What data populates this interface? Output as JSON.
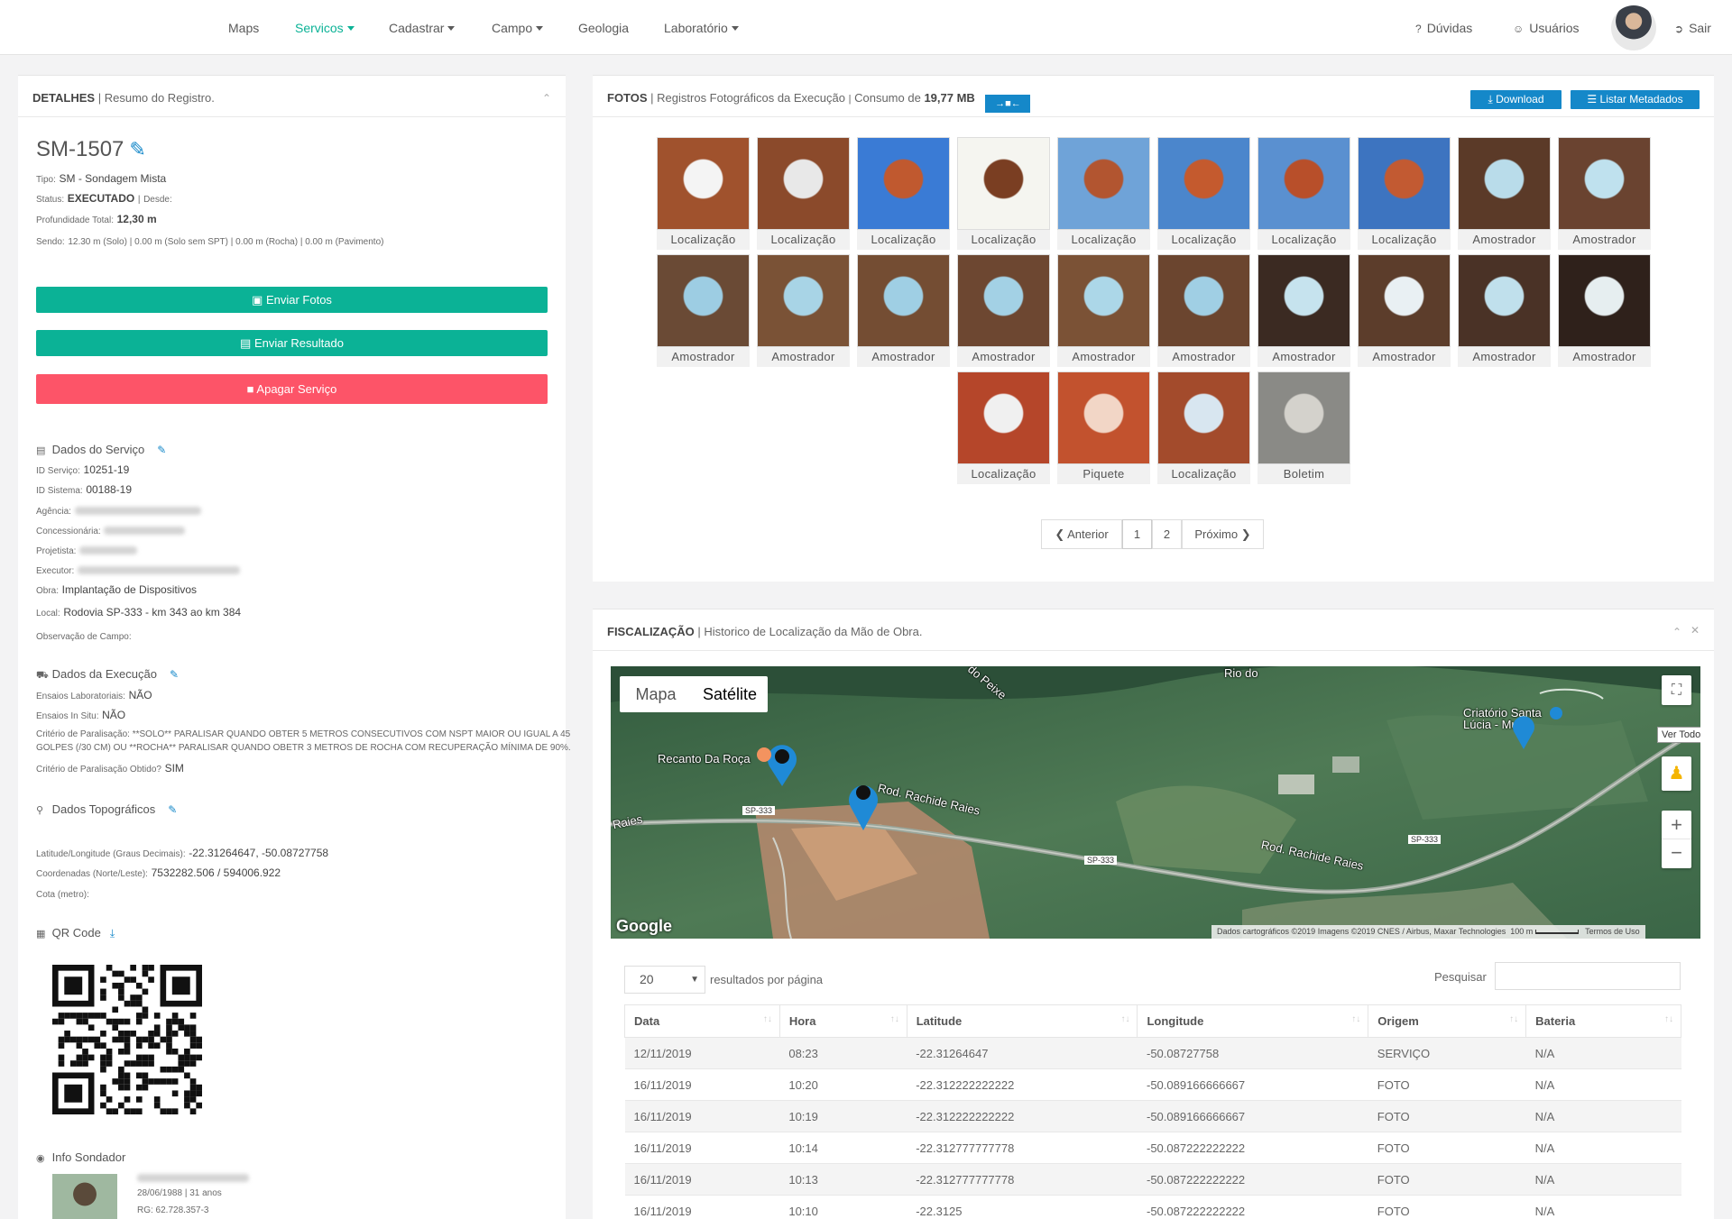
{
  "nav": {
    "items": [
      {
        "label": "Maps",
        "dropdown": false
      },
      {
        "label": "Servicos",
        "dropdown": true
      },
      {
        "label": "Cadastrar",
        "dropdown": true
      },
      {
        "label": "Campo",
        "dropdown": true
      },
      {
        "label": "Geologia",
        "dropdown": false
      },
      {
        "label": "Laboratório",
        "dropdown": true
      }
    ],
    "duvidas": "Dúvidas",
    "usuarios": "Usuários",
    "sair": "Sair",
    "accent": "#0bb296"
  },
  "detalhes": {
    "head_title": "DETALHES",
    "head_sub": "Resumo do Registro.",
    "code": "SM-1507",
    "tipo_label": "Tipo:",
    "tipo": "SM - Sondagem Mista",
    "status_label": "Status:",
    "status": "EXECUTADO",
    "desde_label": "Desde:",
    "prof_label": "Profundidade Total:",
    "prof": "12,30 m",
    "sendo_label": "Sendo:",
    "sendo": "12.30 m (Solo) | 0.00 m (Solo sem SPT) | 0.00 m (Rocha) | 0.00 m (Pavimento)",
    "btn_fotos": "Enviar Fotos",
    "btn_resultado": "Enviar Resultado",
    "btn_apagar": "Apagar Serviço",
    "green": "#0bb296",
    "red": "#fd5468"
  },
  "servico": {
    "title": "Dados do Serviço",
    "id_servico_label": "ID Serviço:",
    "id_servico": "10251-19",
    "id_sistema_label": "ID Sistema:",
    "id_sistema": "00188-19",
    "agencia_label": "Agência:",
    "concessionaria_label": "Concessionária:",
    "projetista_label": "Projetista:",
    "executor_label": "Executor:",
    "obra_label": "Obra:",
    "obra": "Implantação de Dispositivos",
    "local_label": "Local:",
    "local": "Rodovia SP-333 - km 343 ao km 384",
    "obs_label": "Observação de Campo:"
  },
  "execucao": {
    "title": "Dados da Execução",
    "lab_label": "Ensaios Laboratoriais:",
    "lab": "NÃO",
    "insitu_label": "Ensaios In Situ:",
    "insitu": "NÃO",
    "criterio_label": "Critério de Paralisação:",
    "criterio_1": "**SOLO** PARALISAR QUANDO OBTER 5 METROS CONSECUTIVOS COM NSPT MAIOR OU IGUAL A 45",
    "criterio_2": "GOLPES (/30 CM) OU **ROCHA** PARALISAR QUANDO OBETR 3 METROS DE ROCHA COM RECUPERAÇÃO MÍNIMA DE 90%.",
    "obtido_label": "Critério de Paralisação Obtido?",
    "obtido": "SIM"
  },
  "topo": {
    "title": "Dados Topográficos",
    "latlon_label": "Latitude/Longitude (Graus Decimais):",
    "latlon": "-22.31264647, -50.08727758",
    "coord_label": "Coordenadas (Norte/Leste):",
    "coord": "7532282.506 / 594006.922",
    "cota_label": "Cota (metro):"
  },
  "qr": {
    "title": "QR Code"
  },
  "sondador": {
    "title": "Info Sondador",
    "nasc": "28/06/1988 | 31 anos",
    "rg": "RG: 62.728.357-3"
  },
  "fotos": {
    "head_title": "FOTOS",
    "head_sub": "Registros Fotográficos da Execução",
    "consumo_label": "Consumo de",
    "consumo": "19,77 MB",
    "download": "Download",
    "listar": "Listar Metadados",
    "items": [
      {
        "cap": "Localização",
        "c1": "#a0522d",
        "c2": "#f4f4f4"
      },
      {
        "cap": "Localização",
        "c1": "#8b4a2b",
        "c2": "#e8e8e8"
      },
      {
        "cap": "Localização",
        "c1": "#3a7bd5",
        "c2": "#c0592f"
      },
      {
        "cap": "Localização",
        "c1": "#f5f5f0",
        "c2": "#7a3e22"
      },
      {
        "cap": "Localização",
        "c1": "#6fa3d8",
        "c2": "#b25530"
      },
      {
        "cap": "Localização",
        "c1": "#4b86cc",
        "c2": "#c45a2e"
      },
      {
        "cap": "Localização",
        "c1": "#5a90d0",
        "c2": "#b84f2a"
      },
      {
        "cap": "Localização",
        "c1": "#3d74c0",
        "c2": "#c25a32"
      },
      {
        "cap": "Amostrador",
        "c1": "#5b3a28",
        "c2": "#b9dcea"
      },
      {
        "cap": "Amostrador",
        "c1": "#6a4330",
        "c2": "#bfe1ee"
      },
      {
        "cap": "Amostrador",
        "c1": "#6a4a35",
        "c2": "#9dcde3"
      },
      {
        "cap": "Amostrador",
        "c1": "#7a5236",
        "c2": "#a8d4e6"
      },
      {
        "cap": "Amostrador",
        "c1": "#744d33",
        "c2": "#9fcfe4"
      },
      {
        "cap": "Amostrador",
        "c1": "#6d4731",
        "c2": "#a3d1e5"
      },
      {
        "cap": "Amostrador",
        "c1": "#7b5236",
        "c2": "#acd7e8"
      },
      {
        "cap": "Amostrador",
        "c1": "#6b452f",
        "c2": "#a0cfe4"
      },
      {
        "cap": "Amostrador",
        "c1": "#3b2a22",
        "c2": "#c6e3ee"
      },
      {
        "cap": "Amostrador",
        "c1": "#5c3d2b",
        "c2": "#e9f0f3"
      },
      {
        "cap": "Amostrador",
        "c1": "#4a3226",
        "c2": "#c0e0ec"
      },
      {
        "cap": "Amostrador",
        "c1": "#2f211b",
        "c2": "#e6eef0"
      },
      {
        "cap": "Localização",
        "c1": "#b5462a",
        "c2": "#f0f0f0"
      },
      {
        "cap": "Piquete",
        "c1": "#c2522e",
        "c2": "#f2d6c6"
      },
      {
        "cap": "Localização",
        "c1": "#a34b2c",
        "c2": "#d8e6f0"
      },
      {
        "cap": "Boletim",
        "c1": "#8a8a86",
        "c2": "#d4d2cc"
      }
    ],
    "pager": {
      "prev": "Anterior",
      "p1": "1",
      "p2": "2",
      "next": "Próximo"
    }
  },
  "fiscalizacao": {
    "head_title": "FISCALIZAÇÃO",
    "head_sub": "Historico de Localização da Mão de Obra.",
    "map_tab_mapa": "Mapa",
    "map_tab_sat": "Satélite",
    "ver_todos": "Ver Todos",
    "labels": {
      "recanto": "Recanto Da Roça",
      "criatorio1": "Criatório Santa",
      "criatorio2": "Lúcia - Mua",
      "rod1": "Rod. Rachide Raies",
      "rod2": "Rod. Rachide Raies",
      "peixe": "do Peixe",
      "rio": "Rio do",
      "raies": "Raies",
      "sp1": "SP-333",
      "sp2": "SP-333",
      "sp3": "SP-333"
    },
    "google": "Google",
    "attrib": "Dados cartográficos ©2019 Imagens ©2019 CNES / Airbus, Maxar Technologies",
    "scale": "100 m",
    "terms": "Termos de Uso",
    "per_page_value": "20",
    "per_page_label": "resultados por página",
    "search_label": "Pesquisar",
    "columns": [
      "Data",
      "Hora",
      "Latitude",
      "Longitude",
      "Origem",
      "Bateria"
    ],
    "rows": [
      [
        "12/11/2019",
        "08:23",
        "-22.31264647",
        "-50.08727758",
        "SERVIÇO",
        "N/A"
      ],
      [
        "16/11/2019",
        "10:20",
        "-22.312222222222",
        "-50.089166666667",
        "FOTO",
        "N/A"
      ],
      [
        "16/11/2019",
        "10:19",
        "-22.312222222222",
        "-50.089166666667",
        "FOTO",
        "N/A"
      ],
      [
        "16/11/2019",
        "10:14",
        "-22.312777777778",
        "-50.087222222222",
        "FOTO",
        "N/A"
      ],
      [
        "16/11/2019",
        "10:13",
        "-22.312777777778",
        "-50.087222222222",
        "FOTO",
        "N/A"
      ],
      [
        "16/11/2019",
        "10:10",
        "-22.3125",
        "-50.087222222222",
        "FOTO",
        "N/A"
      ]
    ]
  }
}
